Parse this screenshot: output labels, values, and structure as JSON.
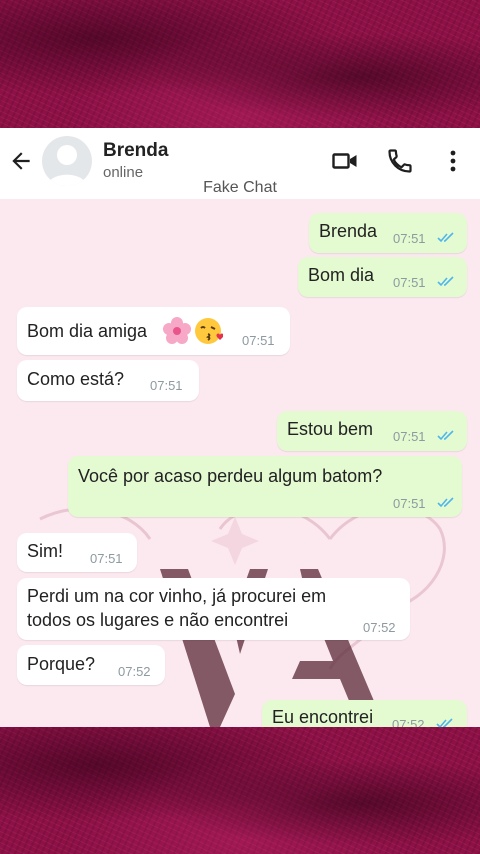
{
  "header": {
    "contact_name": "Brenda",
    "status": "online",
    "title": "Fake Chat"
  },
  "messages": [
    {
      "side": "out",
      "text": "Brenda",
      "time": "07:51"
    },
    {
      "side": "out",
      "text": "Bom dia",
      "time": "07:51"
    },
    {
      "side": "in",
      "text": "Bom dia amiga",
      "time": "07:51"
    },
    {
      "side": "in",
      "text": "Como está?",
      "time": "07:51"
    },
    {
      "side": "out",
      "text": "Estou bem",
      "time": "07:51"
    },
    {
      "side": "out",
      "text": "Você por acaso perdeu algum batom?",
      "time": "07:51"
    },
    {
      "side": "in",
      "text": "Sim!",
      "time": "07:51"
    },
    {
      "side": "in",
      "line1": "Perdi um na cor vinho, já procurei em",
      "line2": "todos os lugares e não encontrei",
      "time": "07:52"
    },
    {
      "side": "in",
      "text": "Porque?",
      "time": "07:52"
    },
    {
      "side": "out",
      "text": "Eu encontrei",
      "time": "07:52"
    }
  ],
  "icons": {
    "back": "arrow-left-icon",
    "video": "video-call-icon",
    "call": "phone-icon",
    "menu": "more-vertical-icon",
    "read_receipt": "double-check-icon"
  },
  "colors": {
    "outgoing_bubble": "#e4fad1",
    "incoming_bubble": "#ffffff",
    "chat_background": "#fbe9ef",
    "read_tick": "#4fb6ec",
    "frame": "#8e1046"
  }
}
